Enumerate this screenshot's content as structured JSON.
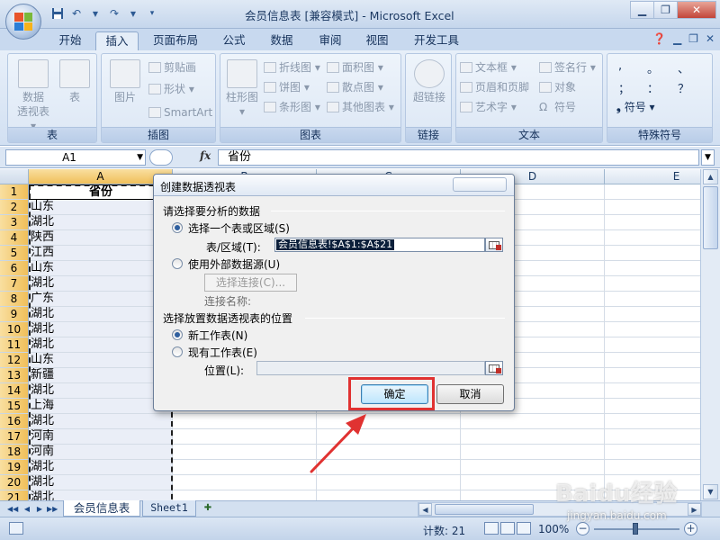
{
  "window": {
    "title": "会员信息表 [兼容模式] - Microsoft Excel"
  },
  "ribbon_tabs": [
    "开始",
    "插入",
    "页面布局",
    "公式",
    "数据",
    "审阅",
    "视图",
    "开发工具"
  ],
  "active_tab": "插入",
  "ribbon": {
    "groups": {
      "table": {
        "label": "表",
        "pivot_label_line1": "数据",
        "pivot_label_line2": "透视表",
        "table_label": "表"
      },
      "illustrations": {
        "label": "插图",
        "picture": "图片",
        "clipart": "剪贴画",
        "shapes": "形状",
        "smartart": "SmartArt"
      },
      "charts": {
        "label": "图表",
        "column": "柱形图",
        "line": "折线图",
        "pie": "饼图",
        "bar": "条形图",
        "area": "面积图",
        "scatter": "散点图",
        "other": "其他图表"
      },
      "links": {
        "label": "链接",
        "hyperlink": "超链接"
      },
      "text": {
        "label": "文本",
        "textbox": "文本框",
        "header_footer": "页眉和页脚",
        "wordart": "艺术字",
        "signature": "签名行",
        "object": "对象",
        "symbol": "符号"
      },
      "special": {
        "label": "特殊符号",
        "chars": [
          ",",
          "。",
          "、",
          "；",
          "：",
          "？"
        ],
        "symbol": "符号"
      }
    }
  },
  "formula_bar": {
    "name_box": "A1",
    "fx": "fx",
    "content": "省份"
  },
  "sheet": {
    "columns": [
      "A",
      "B",
      "C",
      "D",
      "E"
    ],
    "rows": [
      {
        "num": "1",
        "a": "省份"
      },
      {
        "num": "2",
        "a": "山东"
      },
      {
        "num": "3",
        "a": "湖北"
      },
      {
        "num": "4",
        "a": "陕西"
      },
      {
        "num": "5",
        "a": "江西"
      },
      {
        "num": "6",
        "a": "山东"
      },
      {
        "num": "7",
        "a": "湖北"
      },
      {
        "num": "8",
        "a": "广东"
      },
      {
        "num": "9",
        "a": "湖北"
      },
      {
        "num": "10",
        "a": "湖北"
      },
      {
        "num": "11",
        "a": "湖北"
      },
      {
        "num": "12",
        "a": "山东"
      },
      {
        "num": "13",
        "a": "新疆"
      },
      {
        "num": "14",
        "a": "湖北"
      },
      {
        "num": "15",
        "a": "上海"
      },
      {
        "num": "16",
        "a": "湖北"
      },
      {
        "num": "17",
        "a": "河南"
      },
      {
        "num": "18",
        "a": "河南"
      },
      {
        "num": "19",
        "a": "湖北"
      },
      {
        "num": "20",
        "a": "湖北"
      },
      {
        "num": "21",
        "a": "湖北"
      }
    ]
  },
  "sheet_tabs": [
    "会员信息表",
    "Sheet1"
  ],
  "active_sheet": "会员信息表",
  "status_bar": {
    "count": "计数: 21",
    "zoom": "100%"
  },
  "dialog": {
    "title": "创建数据透视表",
    "section_data": "请选择要分析的数据",
    "opt_select_range": "选择一个表或区域(S)",
    "range_label": "表/区域(T):",
    "range_value": "会员信息表!$A$1:$A$21",
    "opt_external": "使用外部数据源(U)",
    "choose_connection": "选择连接(C)...",
    "connection_name": "连接名称:",
    "section_location": "选择放置数据透视表的位置",
    "opt_new_sheet": "新工作表(N)",
    "opt_existing_sheet": "现有工作表(E)",
    "location_label": "位置(L):",
    "ok": "确定",
    "cancel": "取消"
  },
  "annotation": {
    "highlight_color": "#e03231"
  },
  "watermark": {
    "brand": "Baidu经验",
    "url": "jingyan.baidu.com"
  }
}
